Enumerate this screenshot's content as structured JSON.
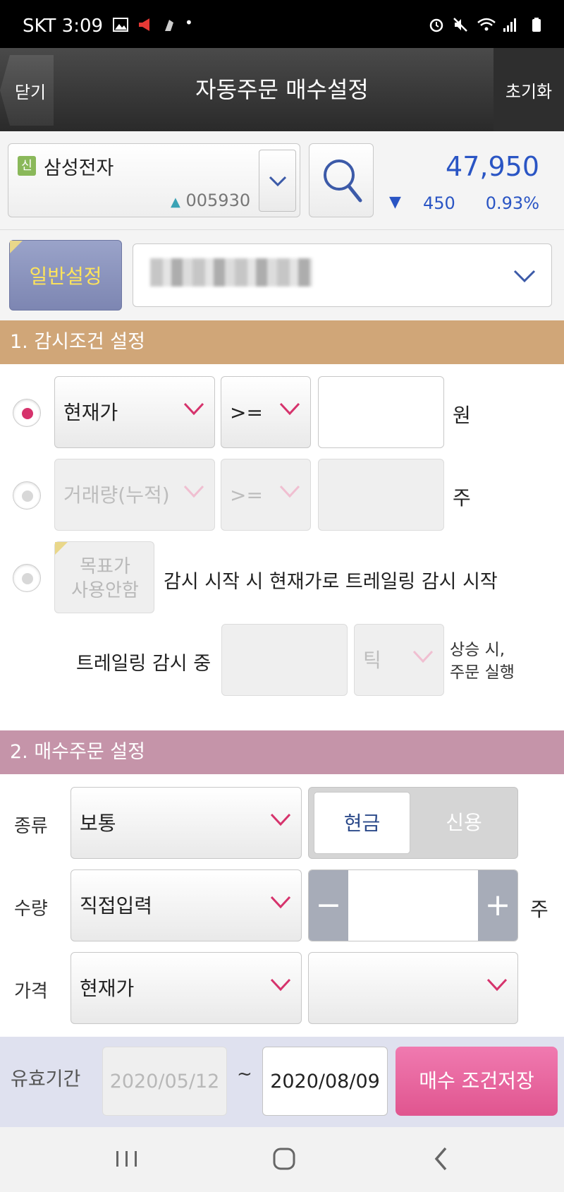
{
  "status_bar": {
    "carrier_time": "SKT 3:09"
  },
  "header": {
    "close_label": "닫기",
    "title": "자동주문 매수설정",
    "reset_label": "초기화"
  },
  "stock": {
    "badge": "신",
    "name": "삼성전자",
    "code": "005930",
    "price": "47,950",
    "change_arrow": "▼",
    "change": "450",
    "change_pct": "0.93%"
  },
  "settings": {
    "general_label": "일반설정"
  },
  "section1": {
    "title": "1. 감시조건 설정",
    "row1": {
      "field": "현재가",
      "operator": ">=",
      "unit": "원"
    },
    "row2": {
      "field": "거래량(누적)",
      "operator": ">=",
      "unit": "주"
    },
    "row3": {
      "target_line1": "목표가",
      "target_line2": "사용안함",
      "text": "감시 시작 시 현재가로 트레일링 감시 시작"
    },
    "trailing": {
      "label": "트레일링 감시 중",
      "tick_unit": "틱",
      "suffix_line1": "상승 시,",
      "suffix_line2": "주문 실행"
    }
  },
  "section2": {
    "title": "2. 매수주문 설정",
    "type": {
      "label": "종류",
      "value": "보통",
      "cash": "현금",
      "credit": "신용"
    },
    "quantity": {
      "label": "수량",
      "value": "직접입력",
      "minus": "−",
      "plus": "+",
      "unit": "주"
    },
    "price": {
      "label": "가격",
      "value": "현재가"
    }
  },
  "footer": {
    "validity_label": "유효기간",
    "start_date": "2020/05/12",
    "tilde": "~",
    "end_date": "2020/08/09",
    "save_label": "매수 조건저장"
  },
  "colors": {
    "section1": "#d0a678",
    "section2": "#c594a9",
    "accent_pink": "#d6336c",
    "price_blue": "#2a55c4"
  }
}
